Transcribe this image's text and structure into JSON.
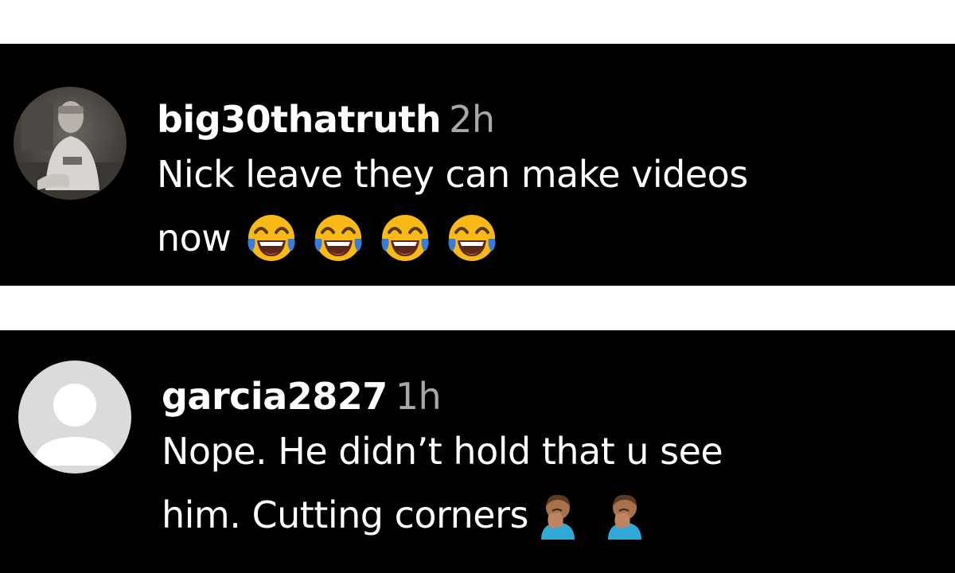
{
  "comments": [
    {
      "username": "big30thatruth",
      "timestamp": "2h",
      "text_line1": "Nick leave they can make videos",
      "text_line2": "now",
      "emojis": [
        "face-with-tears-of-joy-icon",
        "face-with-tears-of-joy-icon",
        "face-with-tears-of-joy-icon",
        "face-with-tears-of-joy-icon"
      ],
      "avatar": "profile-photo"
    },
    {
      "username": "garcia2827",
      "timestamp": "1h",
      "text_line1": "Nope. He didn’t hold that u see",
      "text_line2": "him. Cutting corners",
      "emojis": [
        "person-facepalming-icon",
        "person-facepalming-icon"
      ],
      "avatar": "default-avatar"
    }
  ],
  "colors": {
    "background": "#000000",
    "text": "#ffffff",
    "timestamp": "#a8a8a8",
    "separator": "#ffffff"
  }
}
